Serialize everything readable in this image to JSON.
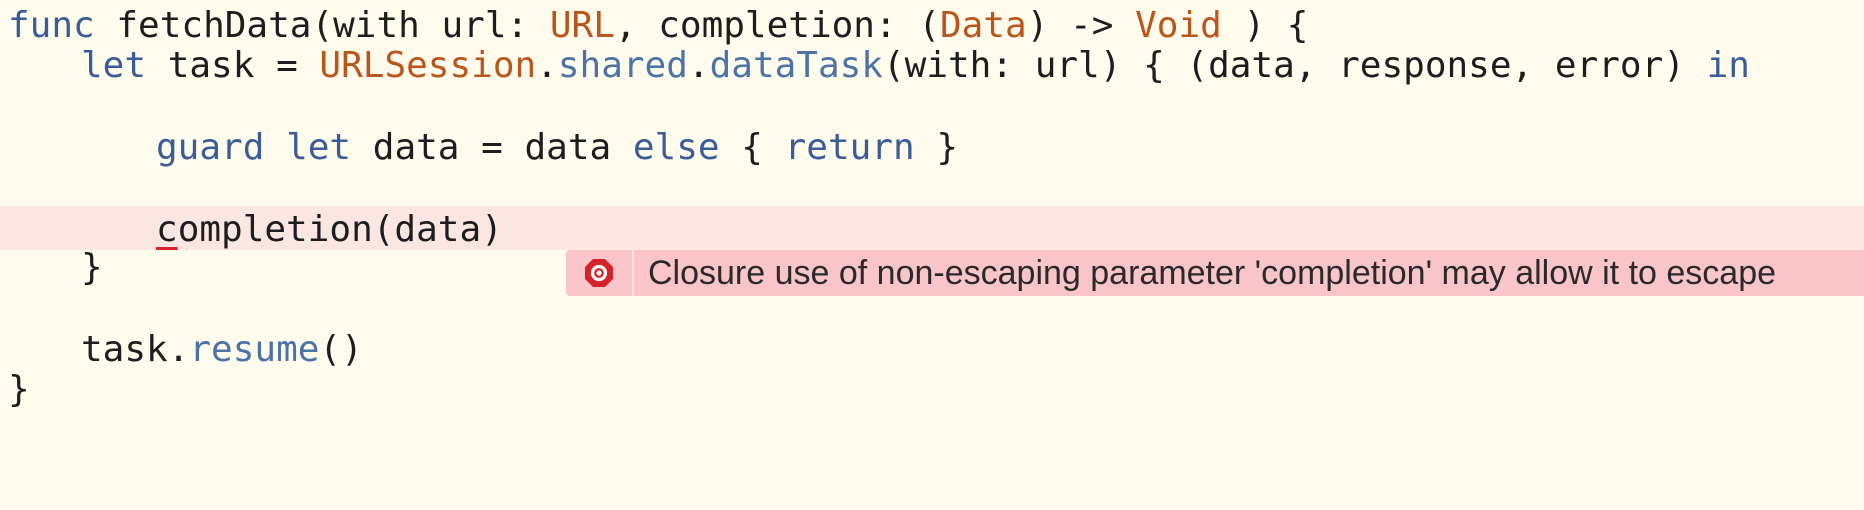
{
  "editor": {
    "lines": [
      {
        "tokens": [
          {
            "text": "func",
            "kind": "kw"
          },
          {
            "text": " fetchData(with url: ",
            "kind": "tx"
          },
          {
            "text": "URL",
            "kind": "ty"
          },
          {
            "text": ", completion: (",
            "kind": "tx"
          },
          {
            "text": "Data",
            "kind": "ty"
          },
          {
            "text": ") -> ",
            "kind": "tx"
          },
          {
            "text": "Void",
            "kind": "ty"
          },
          {
            "text": " ) {",
            "kind": "tx"
          }
        ]
      },
      {
        "tokens": [
          {
            "text": "let",
            "kind": "kw"
          },
          {
            "text": " task = ",
            "kind": "tx"
          },
          {
            "text": "URLSession",
            "kind": "ty"
          },
          {
            "text": ".",
            "kind": "tx"
          },
          {
            "text": "shared",
            "kind": "fn"
          },
          {
            "text": ".",
            "kind": "tx"
          },
          {
            "text": "dataTask",
            "kind": "fn"
          },
          {
            "text": "(with: url) { (data, response, error) ",
            "kind": "tx"
          },
          {
            "text": "in",
            "kind": "kw"
          }
        ]
      },
      {
        "tokens": [
          {
            "text": "guard",
            "kind": "kw"
          },
          {
            "text": " ",
            "kind": "tx"
          },
          {
            "text": "let",
            "kind": "kw"
          },
          {
            "text": " data = data ",
            "kind": "tx"
          },
          {
            "text": "else",
            "kind": "kw"
          },
          {
            "text": " { ",
            "kind": "tx"
          },
          {
            "text": "return",
            "kind": "kw"
          },
          {
            "text": " }",
            "kind": "tx"
          }
        ]
      },
      {
        "error": true,
        "tokens": [
          {
            "text": "c",
            "kind": "tx",
            "underline": true
          },
          {
            "text": "ompletion(data)",
            "kind": "tx"
          }
        ]
      },
      {
        "tokens": [
          {
            "text": "}",
            "kind": "tx"
          }
        ]
      },
      {
        "tokens": [
          {
            "text": "task.",
            "kind": "tx"
          },
          {
            "text": "resume",
            "kind": "fn"
          },
          {
            "text": "()",
            "kind": "tx"
          }
        ]
      },
      {
        "tokens": [
          {
            "text": "}",
            "kind": "tx"
          }
        ]
      }
    ]
  },
  "diagnostic": {
    "severity": "error",
    "icon": "error-stop-icon",
    "message": "Closure use of non-escaping parameter 'completion' may allow it to escape"
  },
  "colors": {
    "background": "#fefbec",
    "keyword": "#3a5d99",
    "type": "#b9561c",
    "function": "#4b73a6",
    "text": "#1d1d1d",
    "error_line": "#fbe6e2",
    "error_banner": "#f9c5c9",
    "error_icon": "#d5222c"
  }
}
